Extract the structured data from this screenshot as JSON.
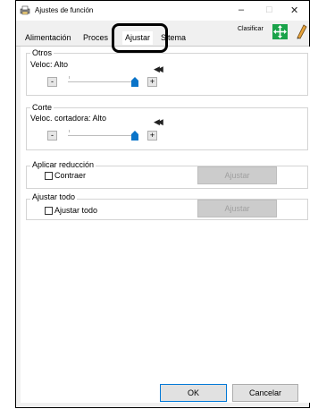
{
  "window": {
    "title": "Ajustes de función",
    "controls": [
      "–",
      "□",
      "✕"
    ]
  },
  "tabs": [
    {
      "label": "Alimentación",
      "active": false
    },
    {
      "label": "Proces",
      "active": false
    },
    {
      "label": "Ajustar",
      "active": true
    },
    {
      "label": "S",
      "active": false
    },
    {
      "label": "tema",
      "active": false
    }
  ],
  "toolbar": {
    "classify_label": "Clasificar",
    "classify_icon": "four-arrows-icon",
    "edit_icon": "pencil-icon"
  },
  "groups": {
    "otros": {
      "title": "Otros",
      "speed_label": "Veloc: Alto",
      "minus": "-",
      "plus": "+",
      "level": 1.0
    },
    "corte": {
      "title": "Corte",
      "speed_label": "Veloc. cortadora: Alto",
      "minus": "-",
      "plus": "+",
      "level": 1.0
    },
    "reduccion": {
      "title": "Aplicar reducción",
      "checkbox_label": "Contraer",
      "checked": false,
      "button_label": "Ajustar"
    },
    "todo": {
      "title": "Ajustar todo",
      "checkbox_label": "Ajustar todo",
      "checked": false,
      "button_label": "Ajustar"
    }
  },
  "footer": {
    "ok_label": "OK",
    "cancel_label": "Cancelar"
  },
  "colors": {
    "accent": "#0078d7",
    "thumb": "#0a74c9",
    "classify_green": "#1aa34a"
  }
}
